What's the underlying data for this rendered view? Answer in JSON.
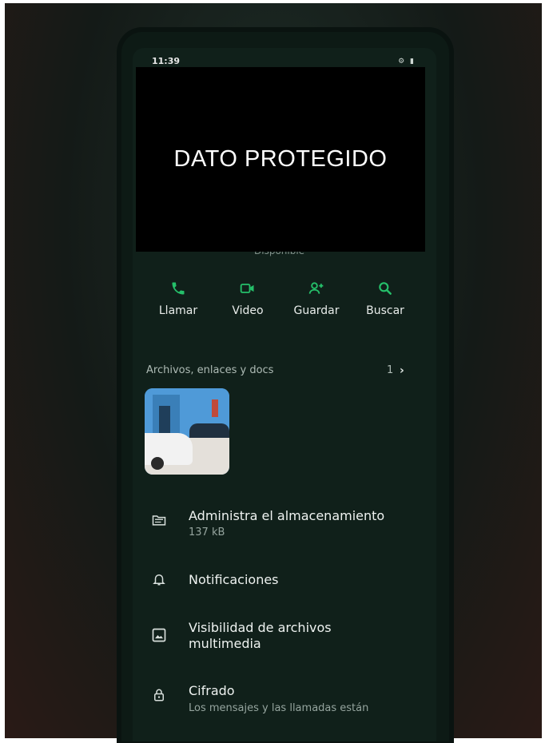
{
  "status_bar": {
    "time": "11:39",
    "right_icons": [
      "settings-icon",
      "battery-icon"
    ]
  },
  "redaction": {
    "label": "DATO PROTEGIDO"
  },
  "contact": {
    "status_text": "Disponible"
  },
  "actions": [
    {
      "label": "Llamar",
      "icon": "phone-icon"
    },
    {
      "label": "Video",
      "icon": "video-camera-icon"
    },
    {
      "label": "Guardar",
      "icon": "add-contact-icon"
    },
    {
      "label": "Buscar",
      "icon": "search-icon"
    }
  ],
  "media": {
    "title": "Archivos, enlaces y docs",
    "count": "1",
    "chevron": "›"
  },
  "menu": [
    {
      "title": "Administra el almacenamiento",
      "subtitle": "137 kB",
      "icon": "folder-icon"
    },
    {
      "title": "Notificaciones",
      "icon": "bell-icon"
    },
    {
      "title": "Visibilidad de archivos",
      "title2": "multimedia",
      "icon": "image-icon"
    },
    {
      "title": "Cifrado",
      "subtitle": "Los mensajes y las llamadas están",
      "icon": "lock-icon"
    }
  ],
  "colors": {
    "accent": "#25c06a",
    "background": "#10201a",
    "text": "#eef2f0",
    "muted": "#95a49e"
  }
}
